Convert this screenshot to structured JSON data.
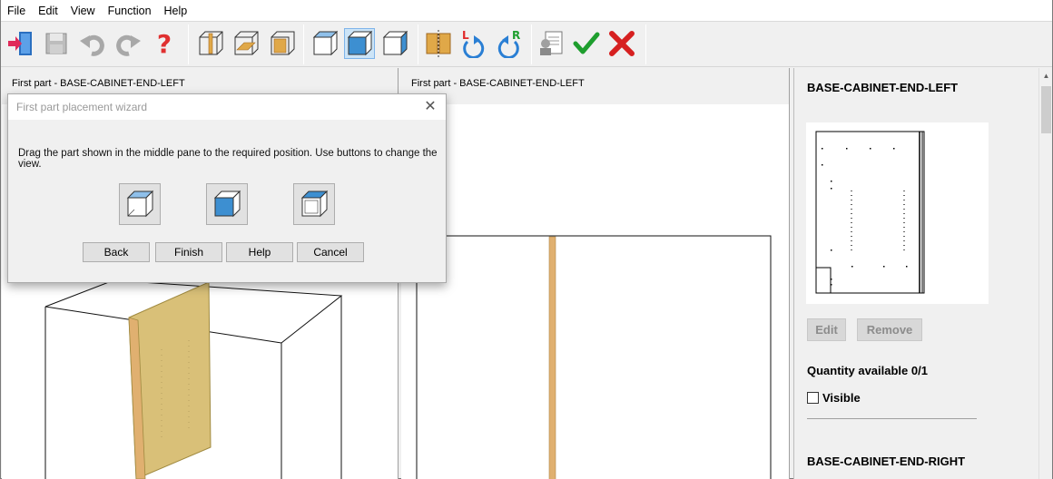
{
  "menu": [
    "File",
    "Edit",
    "View",
    "Function",
    "Help"
  ],
  "toolbar": {
    "icons": [
      "exit-icon",
      "save-icon",
      "undo-icon",
      "redo-icon",
      "help-icon",
      "part-front-view-icon",
      "part-top-view-icon",
      "part-side-view-icon",
      "box-view-1-icon",
      "box-view-2-icon",
      "box-view-3-icon",
      "align-parts-icon",
      "rotate-left-icon",
      "rotate-right-icon",
      "properties-icon",
      "accept-icon",
      "cancel-icon"
    ],
    "active": "box-view-2-icon"
  },
  "left_pane": {
    "header": "First part - BASE-CABINET-END-LEFT"
  },
  "middle_pane": {
    "header": "First part - BASE-CABINET-END-LEFT"
  },
  "wizard": {
    "title": "First part placement wizard",
    "instruction": "Drag the part shown in the middle pane to the required position. Use buttons to change the view.",
    "buttons": {
      "back": "Back",
      "finish": "Finish",
      "help": "Help",
      "cancel": "Cancel"
    }
  },
  "right_panel": {
    "part1_name": "BASE-CABINET-END-LEFT",
    "edit_label": "Edit",
    "remove_label": "Remove",
    "quantity_label": "Quantity available 0/1",
    "visible_label": "Visible",
    "visible_checked": false,
    "part2_name": "BASE-CABINET-END-RIGHT"
  },
  "colors": {
    "panel_wood": "#d9c078",
    "panel_edge": "#e0b070",
    "accent_blue": "#3d8fd1",
    "cancel_red": "#d62020",
    "accept_green": "#1e9e2e"
  }
}
